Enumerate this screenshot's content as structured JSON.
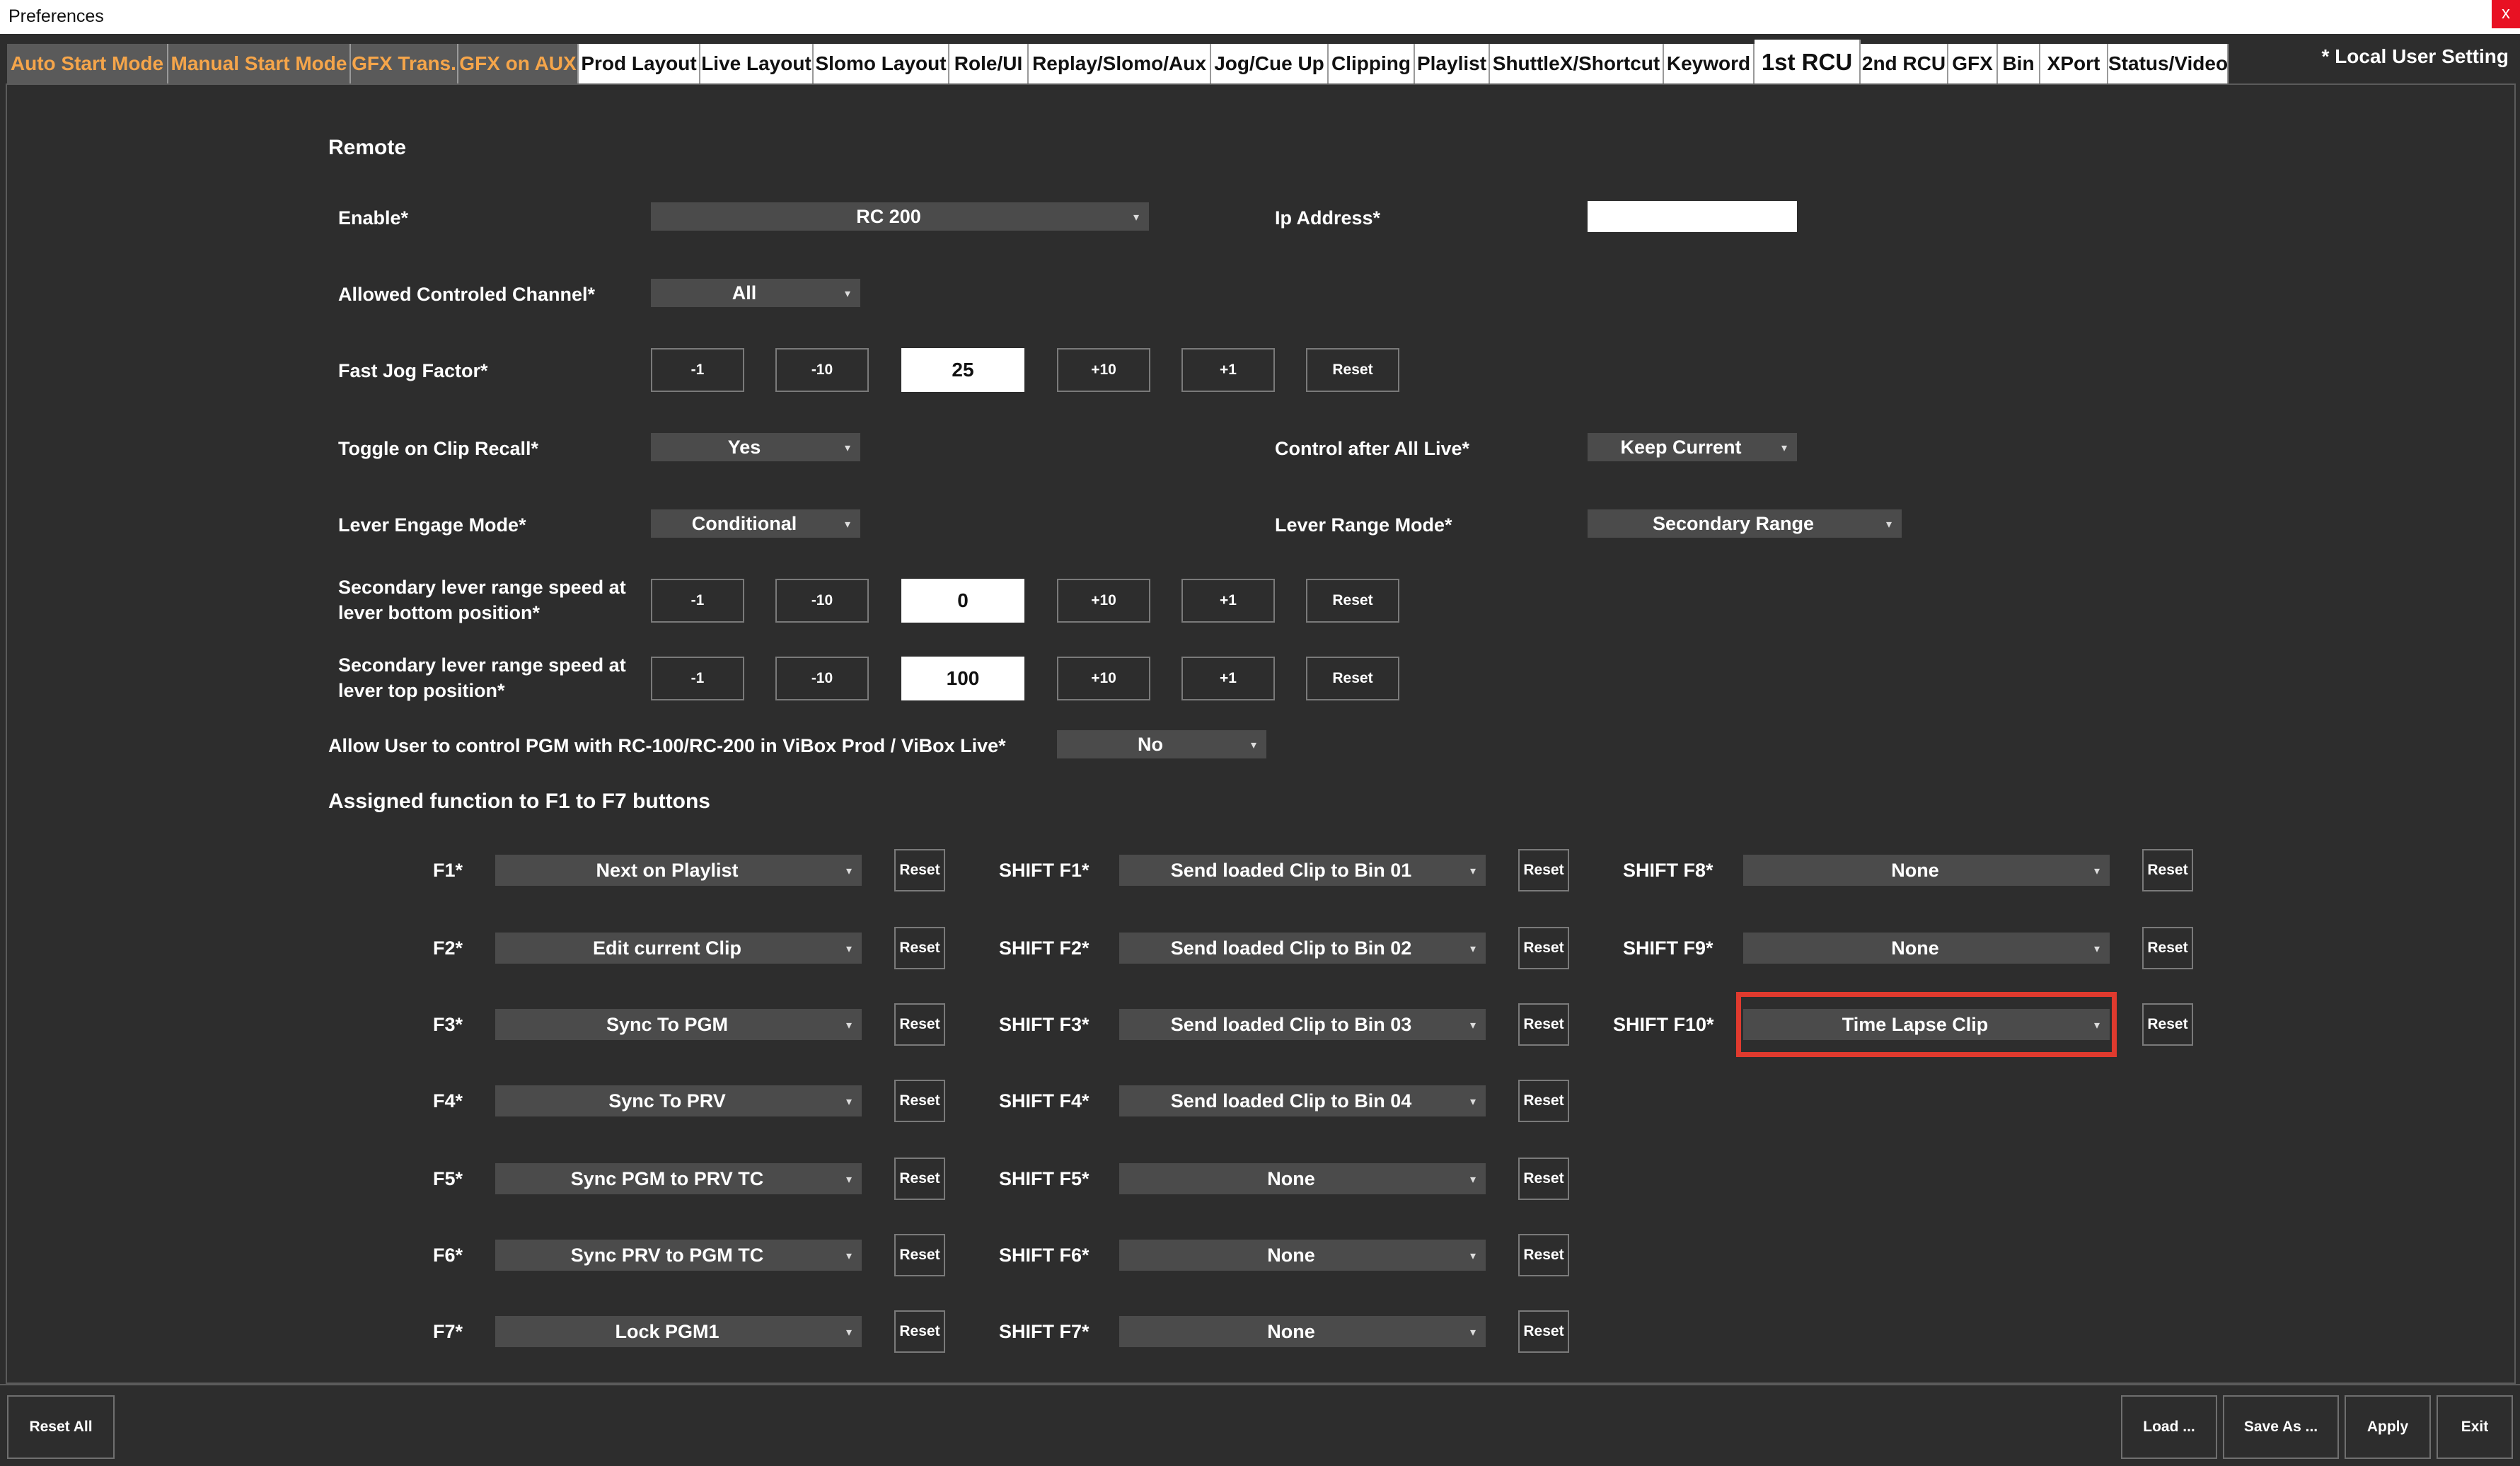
{
  "window": {
    "title": "Preferences",
    "close_label": "x"
  },
  "tabs": [
    {
      "label": "Auto Start Mode"
    },
    {
      "label": "Manual Start Mode"
    },
    {
      "label": "GFX Trans."
    },
    {
      "label": "GFX on AUX"
    },
    {
      "label": "Prod Layout"
    },
    {
      "label": "Live Layout"
    },
    {
      "label": "Slomo Layout"
    },
    {
      "label": "Role/UI"
    },
    {
      "label": "Replay/Slomo/Aux"
    },
    {
      "label": "Jog/Cue Up"
    },
    {
      "label": "Clipping"
    },
    {
      "label": "Playlist"
    },
    {
      "label": "ShuttleX/Shortcut"
    },
    {
      "label": "Keyword"
    },
    {
      "label": "1st RCU"
    },
    {
      "label": "2nd RCU"
    },
    {
      "label": "GFX"
    },
    {
      "label": "Bin"
    },
    {
      "label": "XPort"
    },
    {
      "label": "Status/Video"
    }
  ],
  "active_tab": "1st RCU",
  "local_setting": "* Local User Setting",
  "remote": {
    "title": "Remote",
    "enable": {
      "label": "Enable*",
      "value": "RC 200"
    },
    "ip": {
      "label": "Ip Address*",
      "value": ""
    },
    "allowed_channel": {
      "label": "Allowed Controled Channel*",
      "value": "All"
    },
    "fast_jog": {
      "label": "Fast Jog Factor*",
      "value": "25"
    },
    "toggle_recall": {
      "label": "Toggle on Clip Recall*",
      "value": "Yes"
    },
    "control_after_live": {
      "label": "Control after All Live*",
      "value": "Keep Current"
    },
    "lever_engage": {
      "label": "Lever Engage Mode*",
      "value": "Conditional"
    },
    "lever_range": {
      "label": "Lever Range Mode*",
      "value": "Secondary Range"
    },
    "sec_bottom": {
      "label": "Secondary lever range speed at lever bottom position*",
      "value": "0"
    },
    "sec_top": {
      "label": "Secondary lever range speed at lever top position*",
      "value": "100"
    },
    "allow_pgm": {
      "label": "Allow User to control PGM with RC-100/RC-200 in ViBox Prod / ViBox Live*",
      "value": "No"
    }
  },
  "stepper_labels": {
    "m1": "-1",
    "m10": "-10",
    "p10": "+10",
    "p1": "+1",
    "reset": "Reset"
  },
  "assigned": {
    "title": "Assigned function to F1 to F7 buttons",
    "col1": [
      {
        "label": "F1*",
        "value": "Next on Playlist"
      },
      {
        "label": "F2*",
        "value": "Edit current Clip"
      },
      {
        "label": "F3*",
        "value": "Sync To PGM"
      },
      {
        "label": "F4*",
        "value": "Sync To PRV"
      },
      {
        "label": "F5*",
        "value": "Sync PGM to PRV TC"
      },
      {
        "label": "F6*",
        "value": "Sync PRV to PGM TC"
      },
      {
        "label": "F7*",
        "value": "Lock PGM1"
      }
    ],
    "col2": [
      {
        "label": "SHIFT F1*",
        "value": "Send loaded Clip to Bin 01"
      },
      {
        "label": "SHIFT F2*",
        "value": "Send loaded Clip to Bin 02"
      },
      {
        "label": "SHIFT F3*",
        "value": "Send loaded Clip to Bin 03"
      },
      {
        "label": "SHIFT F4*",
        "value": "Send loaded Clip to Bin 04"
      },
      {
        "label": "SHIFT F5*",
        "value": "None"
      },
      {
        "label": "SHIFT F6*",
        "value": "None"
      },
      {
        "label": "SHIFT F7*",
        "value": "None"
      }
    ],
    "col3": [
      {
        "label": "SHIFT F8*",
        "value": "None"
      },
      {
        "label": "SHIFT F9*",
        "value": "None"
      },
      {
        "label": "SHIFT F10*",
        "value": "Time Lapse Clip"
      }
    ]
  },
  "footer": {
    "reset_all": "Reset All",
    "load": "Load ...",
    "save_as": "Save As ...",
    "apply": "Apply",
    "exit": "Exit"
  },
  "colors": {
    "background": "#2d2d2d",
    "tab_orange_text": "#f5a54a",
    "combo": "#4b4b4b",
    "highlight": "#e03a2e"
  }
}
